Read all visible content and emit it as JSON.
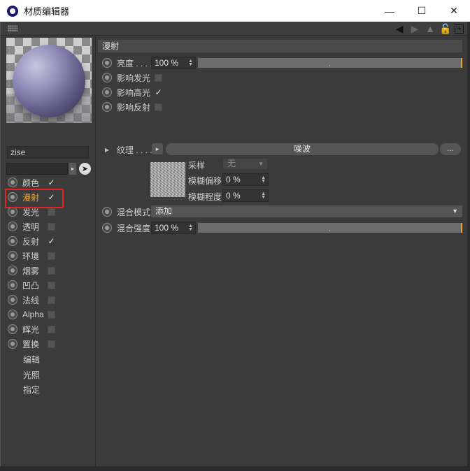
{
  "window": {
    "title": "材质编辑器",
    "minimize": "—",
    "maximize": "☐",
    "close": "✕"
  },
  "preview": {
    "material_name": "zise"
  },
  "channels": [
    {
      "label": "颜色",
      "checked": true
    },
    {
      "label": "漫射",
      "checked": true,
      "active": true
    },
    {
      "label": "发光",
      "checked": false
    },
    {
      "label": "透明",
      "checked": false
    },
    {
      "label": "反射",
      "checked": true
    },
    {
      "label": "环境",
      "checked": false
    },
    {
      "label": "烟雾",
      "checked": false
    },
    {
      "label": "凹凸",
      "checked": false
    },
    {
      "label": "法线",
      "checked": false
    },
    {
      "label": "Alpha",
      "checked": false
    },
    {
      "label": "辉光",
      "checked": false
    },
    {
      "label": "置换",
      "checked": false
    }
  ],
  "extra_items": [
    "编辑",
    "光照",
    "指定"
  ],
  "diffuse": {
    "header": "漫射",
    "brightness_label": "亮度 . . . .",
    "brightness_value": "100 %",
    "affect_luminance_label": "影响发光",
    "affect_specular_label": "影响高光",
    "affect_reflection_label": "影响反射",
    "texture_label": "纹理 . . . .",
    "texture_name": "噪波",
    "more_label": "...",
    "sampling_label": "采样",
    "sampling_value": "无",
    "blur_offset_label": "模糊偏移",
    "blur_offset_value": "0 %",
    "blur_scale_label": "模糊程度",
    "blur_scale_value": "0 %",
    "mix_mode_label": "混合模式",
    "mix_mode_value": "添加",
    "mix_strength_label": "混合强度",
    "mix_strength_value": "100 %"
  },
  "colors": {
    "accent": "#f0a020",
    "active_label": "#f2a73a",
    "highlight": "#e52222"
  }
}
